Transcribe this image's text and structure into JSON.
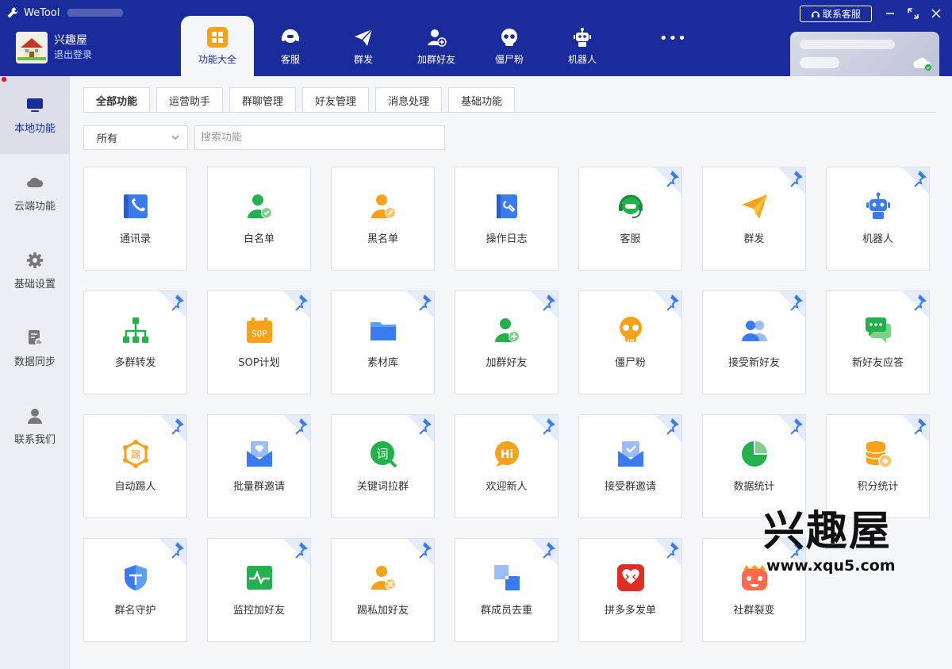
{
  "app": {
    "title": "WeTool",
    "user_name": "兴趣屋",
    "logout": "退出登录",
    "contact": "联系客服",
    "more": "•••"
  },
  "top_tabs": [
    {
      "label": "功能大全",
      "icon": "grid-icon"
    },
    {
      "label": "客服",
      "icon": "headset-icon"
    },
    {
      "label": "群发",
      "icon": "paper-plane-icon"
    },
    {
      "label": "加群好友",
      "icon": "add-user-icon"
    },
    {
      "label": "僵尸粉",
      "icon": "skull-icon"
    },
    {
      "label": "机器人",
      "icon": "robot-icon"
    }
  ],
  "sidebar": [
    {
      "label": "本地功能",
      "icon": "monitor-icon"
    },
    {
      "label": "云端功能",
      "icon": "cloud-icon"
    },
    {
      "label": "基础设置",
      "icon": "gear-icon"
    },
    {
      "label": "数据同步",
      "icon": "sync-data-icon"
    },
    {
      "label": "联系我们",
      "icon": "person-icon"
    }
  ],
  "sub_tabs": [
    "全部功能",
    "运营助手",
    "群聊管理",
    "好友管理",
    "消息处理",
    "基础功能"
  ],
  "filter": {
    "value": "所有",
    "search_placeholder": "搜索功能"
  },
  "features": [
    {
      "label": "通讯录",
      "icon": "contacts-icon",
      "pinned": false
    },
    {
      "label": "白名单",
      "icon": "whitelist-icon",
      "pinned": false
    },
    {
      "label": "黑名单",
      "icon": "blacklist-icon",
      "pinned": false
    },
    {
      "label": "操作日志",
      "icon": "log-book-icon",
      "pinned": false
    },
    {
      "label": "客服",
      "icon": "headset-icon",
      "pinned": true
    },
    {
      "label": "群发",
      "icon": "paper-plane-icon",
      "pinned": true
    },
    {
      "label": "机器人",
      "icon": "robot-icon",
      "pinned": true
    },
    {
      "label": "多群转发",
      "icon": "org-tree-icon",
      "pinned": true
    },
    {
      "label": "SOP计划",
      "icon": "sop-calendar-icon",
      "pinned": true
    },
    {
      "label": "素材库",
      "icon": "folder-icon",
      "pinned": true
    },
    {
      "label": "加群好友",
      "icon": "add-user-icon",
      "pinned": true
    },
    {
      "label": "僵尸粉",
      "icon": "skull-icon",
      "pinned": true
    },
    {
      "label": "接受新好友",
      "icon": "accept-friends-icon",
      "pinned": true
    },
    {
      "label": "新好友应答",
      "icon": "chat-reply-icon",
      "pinned": true
    },
    {
      "label": "自动踢人",
      "icon": "kick-hex-icon",
      "pinned": true
    },
    {
      "label": "批量群邀请",
      "icon": "invite-envelope-icon",
      "pinned": true
    },
    {
      "label": "关键词拉群",
      "icon": "keyword-bubble-icon",
      "pinned": true
    },
    {
      "label": "欢迎新人",
      "icon": "hi-bubble-icon",
      "pinned": true
    },
    {
      "label": "接受群邀请",
      "icon": "accept-invite-icon",
      "pinned": true
    },
    {
      "label": "数据统计",
      "icon": "pie-chart-icon",
      "pinned": true
    },
    {
      "label": "积分统计",
      "icon": "coins-icon",
      "pinned": true
    },
    {
      "label": "群名守护",
      "icon": "shield-icon",
      "pinned": true
    },
    {
      "label": "监控加好友",
      "icon": "monitor-pulse-icon",
      "pinned": true
    },
    {
      "label": "踢私加好友",
      "icon": "kick-user-icon",
      "pinned": true
    },
    {
      "label": "群成员去重",
      "icon": "dedupe-icon",
      "pinned": true
    },
    {
      "label": "拼多多发单",
      "icon": "pinduoduo-icon",
      "pinned": true
    },
    {
      "label": "社群裂变",
      "icon": "fission-face-icon",
      "pinned": true
    }
  ],
  "watermark": {
    "title": "兴趣屋",
    "url": "www.xqu5.com"
  },
  "colors": {
    "topbar": "#1a2b9c",
    "accent_blue": "#3a7bf0",
    "green": "#22b14c",
    "orange": "#f7a21b"
  }
}
